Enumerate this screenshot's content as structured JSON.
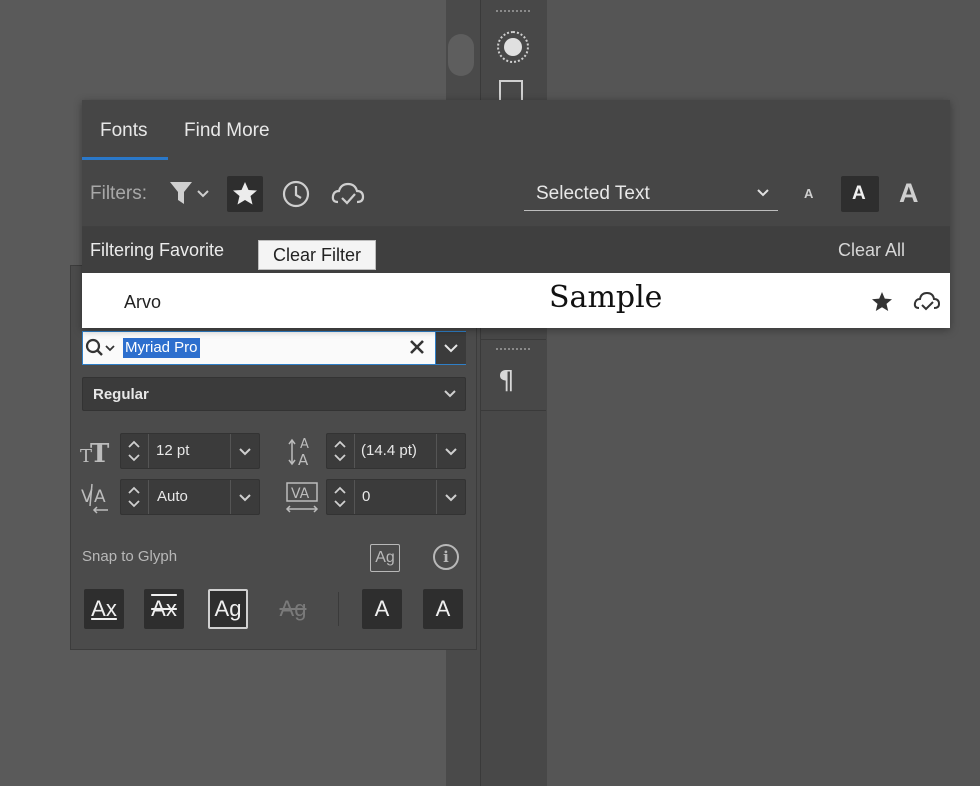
{
  "popup": {
    "tabs": [
      {
        "label": "Fonts",
        "active": true
      },
      {
        "label": "Find More",
        "active": false
      }
    ],
    "filters_label": "Filters:",
    "filter_icons": [
      "filter-funnel-icon",
      "favorite-star-icon",
      "recent-clock-icon",
      "cloud-check-icon"
    ],
    "preview_dropdown": "Selected Text",
    "size_buttons": [
      "A",
      "A",
      "A"
    ],
    "filtering_text": "Filtering Favorite",
    "clear_all": "Clear All",
    "tooltip": "Clear Filter",
    "font_row": {
      "name": "Arvo",
      "sample": "Sample"
    }
  },
  "character": {
    "font_search_value": "Myriad Pro",
    "font_style": "Regular",
    "font_size": "12 pt",
    "leading": "(14.4 pt)",
    "kerning": "Auto",
    "tracking": "0",
    "snap_label": "Snap to Glyph",
    "glyph_buttons": [
      "Ax",
      "Ax",
      "Ag",
      "Ag",
      "A",
      "A"
    ],
    "snap_icon_text": "Ag",
    "info_icon_text": "i"
  },
  "toolstrip": {
    "paragraph_icon": "¶"
  },
  "colors": {
    "accent": "#2a78c9",
    "selection": "#2d6fce",
    "panel": "#464646",
    "background": "#535353"
  }
}
